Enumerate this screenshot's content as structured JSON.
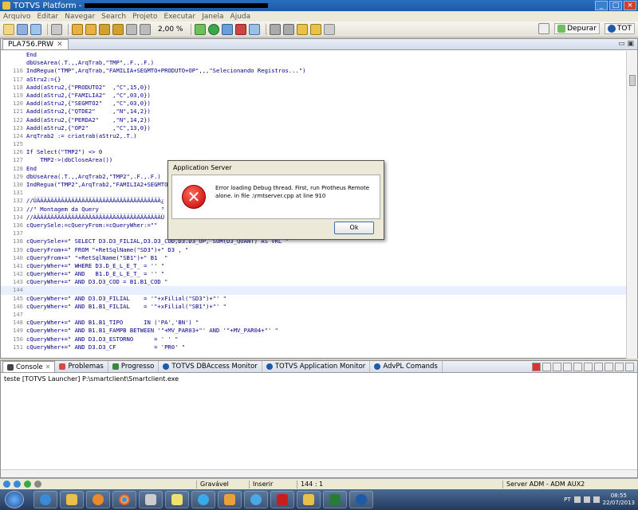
{
  "window": {
    "title": "TOTVS Platform - "
  },
  "menu": [
    "Arquivo",
    "Editar",
    "Navegar",
    "Search",
    "Projeto",
    "Executar",
    "Janela",
    "Ajuda"
  ],
  "toolbar": {
    "zoom": "2,00 %",
    "perspective_debug": "Depurar",
    "perspective_totvs": "TOT"
  },
  "editor": {
    "tab_label": "PLA756.PRW",
    "lines": [
      {
        "n": "",
        "t": "End"
      },
      {
        "n": "",
        "t": "dbUseArea(.T.,,ArqTrab,\"TMP\",.F.,.F.)"
      },
      {
        "n": "116",
        "t": "IndRegua(\"TMP\",ArqTrab,\"FAMILIA+SEGMTO+PRODUTO+OP\",,,\"Selecionando Registros...\")"
      },
      {
        "n": "117",
        "t": "aStru2:={}"
      },
      {
        "n": "118",
        "t": "Aadd(aStru2,{\"PRODUTO2\"  ,\"C\",15,0})"
      },
      {
        "n": "119",
        "t": "Aadd(aStru2,{\"FAMILIA2\"  ,\"C\",03,0})"
      },
      {
        "n": "120",
        "t": "Aadd(aStru2,{\"SEGMTO2\"   ,\"C\",03,0})"
      },
      {
        "n": "121",
        "t": "Aadd(aStru2,{\"QTDE2\"     ,\"N\",14,2})"
      },
      {
        "n": "122",
        "t": "Aadd(aStru2,{\"PERDA2\"    ,\"N\",14,2})"
      },
      {
        "n": "123",
        "t": "Aadd(aStru2,{\"OP2\"       ,\"C\",13,0})"
      },
      {
        "n": "124",
        "t": "ArqTrab2 := criatrab(aStru2,.T.)"
      },
      {
        "n": "125",
        "t": ""
      },
      {
        "n": "126",
        "t": "If Select(\"TMP2\") <> 0",
        "bp": true
      },
      {
        "n": "127",
        "t": "    TMP2->(dbCloseArea())"
      },
      {
        "n": "128",
        "t": "End"
      },
      {
        "n": "129",
        "t": "dbUseArea(.T.,,ArqTrab2,\"TMP2\",.F.,.F.)"
      },
      {
        "n": "130",
        "t": "IndRegua(\"TMP2\",ArqTrab2,\"FAMILIA2+SEGMTO2+PRODUTO2+OP2\",,,\"Selecionando Registros...\")"
      },
      {
        "n": "131",
        "t": ""
      },
      {
        "n": "132",
        "t": "//ÜÄÄÄÄÄÄÄÄÄÄÄÄÄÄÄÄÄÄÄÄÄÄÄÄÄÄÄÄÄÄÄÄÄÄÄÄ¿"
      },
      {
        "n": "133",
        "t": "//³ Montagem da Query                  ³"
      },
      {
        "n": "134",
        "t": "//ÀÄÄÄÄÄÄÄÄÄÄÄÄÄÄÄÄÄÄÄÄÄÄÄÄÄÄÄÄÄÄÄÄÄÄÄÄÙ"
      },
      {
        "n": "136",
        "t": "cQuerySele:=cQueryFrom:=cQueryWher:=\"\""
      },
      {
        "n": "137",
        "t": ""
      },
      {
        "n": "138",
        "t": "cQuerySele+=\" SELECT D3.D3_FILIAL,D3.D3_COD,D3.D3_OP, SUM(D3_QUANT) AS VRL \""
      },
      {
        "n": "139",
        "t": "cQueryFrom+=\" FROM \"+RetSqlName(\"SD3\")+\" D3 , \""
      },
      {
        "n": "140",
        "t": "cQueryFrom+=\" \"+RetSqlName(\"SB1\")+\" B1  \""
      },
      {
        "n": "141",
        "t": "cQueryWher+=\" WHERE D3.D_E_L_E_T_ = '' \""
      },
      {
        "n": "142",
        "t": "cQueryWher+=\" AND   B1.D_E_L_E_T_ = '' \""
      },
      {
        "n": "143",
        "t": "cQueryWher+=\" AND D3.D3_COD = B1.B1_COD \""
      },
      {
        "n": "144",
        "t": "",
        "hl": true
      },
      {
        "n": "145",
        "t": "cQueryWher+=\" AND D3.D3_FILIAL    = '\"+xFilial(\"SD3\")+\"' \""
      },
      {
        "n": "146",
        "t": "cQueryWher+=\" AND B1.B1_FILIAL    = '\"+xFilial(\"SB1\")+\"' \""
      },
      {
        "n": "147",
        "t": ""
      },
      {
        "n": "148",
        "t": "cQueryWher+=\" AND B1.B1_TIPO      IN ('PA','BN') \""
      },
      {
        "n": "149",
        "t": "cQueryWher+=\" AND B1.B1_FAMPB BETWEEN '\"+MV_PAR03+\"' AND '\"+MV_PAR04+\"' \""
      },
      {
        "n": "150",
        "t": "cQueryWher+=\" AND D3.D3_ESTORNO      = ' ' \""
      },
      {
        "n": "151",
        "t": "cQueryWher+=\" AND D3.D3_CF           = 'PR0' \""
      }
    ]
  },
  "dialog": {
    "title": "Application Server",
    "message": "Error loading Debug thread. First, run Protheus Remote alone. in file .\\rmtserver.cpp at line 910",
    "ok": "Ok"
  },
  "console": {
    "tabs": [
      "Console",
      "Problemas",
      "Progresso",
      "TOTVS DBAccess Monitor",
      "TOTVS Application Monitor",
      "AdvPL Comands"
    ],
    "line": "teste [TOTVS Launcher] P:\\smartclient\\Smartclient.exe"
  },
  "status": {
    "writable": "Gravável",
    "insert": "Inserir",
    "position": "144 : 1",
    "server": "Server ADM - ADM AUX2"
  },
  "taskbar": {
    "lang": "PT",
    "time": "08:55",
    "date": "22/07/2013"
  }
}
